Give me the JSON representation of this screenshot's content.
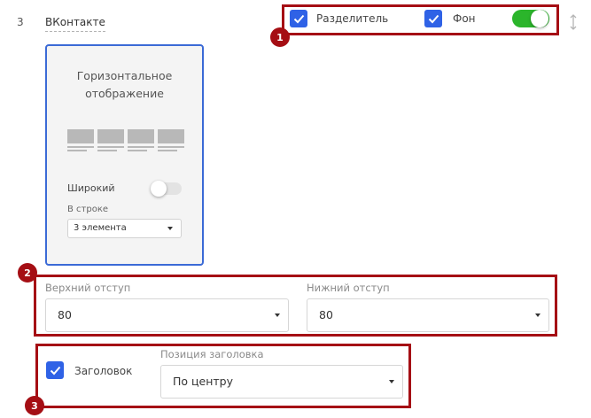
{
  "block": {
    "number": "3",
    "name": "ВКонтакте"
  },
  "top_options": {
    "divider_label": "Разделитель",
    "divider_checked": true,
    "background_label": "Фон",
    "background_checked": true,
    "background_toggle_on": true
  },
  "layout_card": {
    "title": "Горизонтальное отображение",
    "wide_label": "Широкий",
    "wide_enabled": false,
    "in_row_label": "В строке",
    "in_row_value": "3 элемента"
  },
  "spacing": {
    "top_label": "Верхний отступ",
    "top_value": "80",
    "bottom_label": "Нижний отступ",
    "bottom_value": "80"
  },
  "heading": {
    "label": "Заголовок",
    "checked": true,
    "position_label": "Позиция заголовка",
    "position_value": "По центру"
  },
  "markers": [
    "1",
    "2",
    "3"
  ],
  "colors": {
    "highlight": "#a50e14",
    "checkbox": "#2f62e6",
    "toggle_on": "#2bb52b",
    "card_border": "#3b6ad6"
  }
}
